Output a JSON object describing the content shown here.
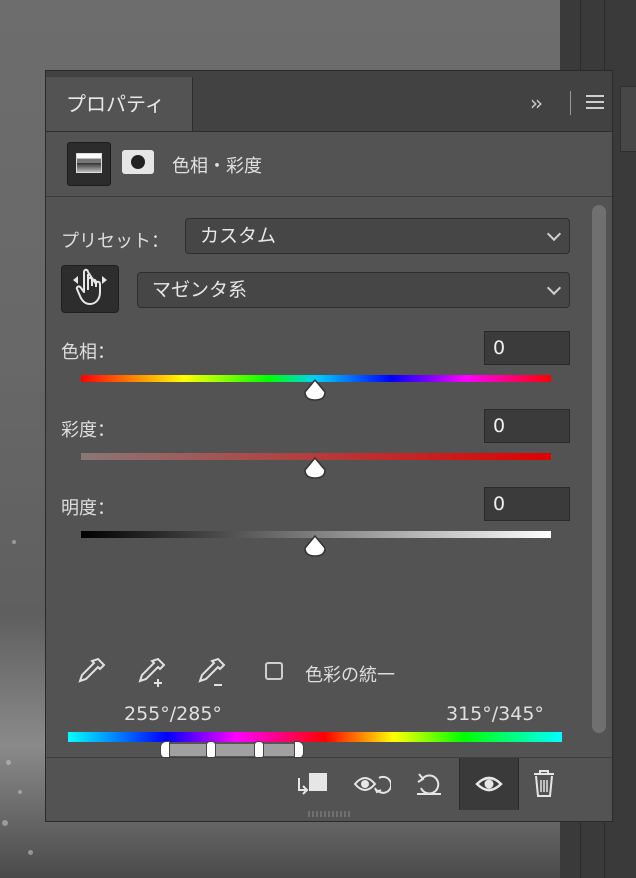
{
  "panel": {
    "tab_label": "プロパティ",
    "title": "色相・彩度"
  },
  "preset": {
    "label": "プリセット：",
    "value": "カスタム"
  },
  "channel": {
    "value": "マゼンタ系"
  },
  "hue": {
    "label": "色相：",
    "value": "0"
  },
  "saturation": {
    "label": "彩度：",
    "value": "0"
  },
  "lightness": {
    "label": "明度：",
    "value": "0"
  },
  "colorize": {
    "label": "色彩の統一",
    "checked": false
  },
  "range": {
    "left_label": "255°/285°",
    "right_label": "315°/345°"
  },
  "colors": {
    "panel_bg": "#535353",
    "tabbar_bg": "#424242",
    "field_bg": "#3b3b3b",
    "text": "#dedede"
  },
  "icons": {
    "expand": "double-chevron-right-icon",
    "menu": "hamburger-menu-icon",
    "adjustment": "hue-saturation-adjustment-icon",
    "mask": "layer-mask-icon",
    "target": "on-image-adjustment-hand-icon",
    "eyedroppers": [
      "eyedropper-icon",
      "eyedropper-add-icon",
      "eyedropper-subtract-icon"
    ],
    "footer": [
      "clip-to-layer-icon",
      "view-previous-state-icon",
      "reset-icon",
      "visibility-eye-icon",
      "trash-icon"
    ]
  }
}
